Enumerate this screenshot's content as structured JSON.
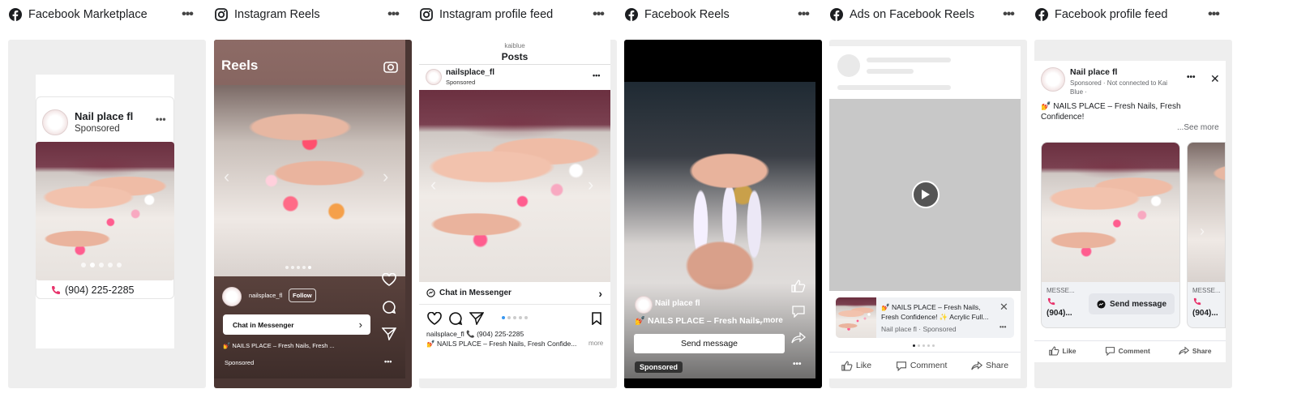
{
  "placements": [
    {
      "name": "Facebook Marketplace",
      "platform": "facebook"
    },
    {
      "name": "Instagram Reels",
      "platform": "instagram"
    },
    {
      "name": "Instagram profile feed",
      "platform": "instagram"
    },
    {
      "name": "Facebook Reels",
      "platform": "facebook"
    },
    {
      "name": "Ads on Facebook Reels",
      "platform": "facebook"
    },
    {
      "name": "Facebook profile feed",
      "platform": "facebook"
    }
  ],
  "more_glyph": "•••",
  "marketplace": {
    "page_name": "Nail place fl",
    "sponsored": "Sponsored",
    "phone": "(904) 225-2285"
  },
  "ig_reels": {
    "title": "Reels",
    "handle": "nailsplace_fl",
    "follow": "Follow",
    "cta": "Chat in Messenger",
    "caption": "💅 NAILS PLACE – Fresh Nails, Fresh ...",
    "sponsored": "Sponsored"
  },
  "ig_profile": {
    "account": "kaiblue",
    "posts": "Posts",
    "handle": "nailsplace_fl",
    "sponsored": "Sponsored",
    "cta": "Chat in Messenger",
    "caption_line1": "nailsplace_fl 📞 (904) 225-2285",
    "caption_line2": "💅 NAILS PLACE – Fresh Nails, Fresh Confide...",
    "more": "more"
  },
  "fb_reels": {
    "page_name": "Nail place fl",
    "caption": "💅 NAILS PLACE – Fresh Nails,",
    "more": "...more",
    "cta": "Send message",
    "sponsored": "Sponsored"
  },
  "ads_fb_reels": {
    "ad_text": "💅 NAILS PLACE – Fresh Nails, Fresh Confidence! ✨ Acrylic Full...",
    "meta": "Nail place fl · Sponsored",
    "like": "Like",
    "comment": "Comment",
    "share": "Share"
  },
  "fb_profile": {
    "page_name": "Nail place fl",
    "meta": "Sponsored · Not connected to Kai Blue ·",
    "text": "💅 NAILS PLACE – Fresh Nails, Fresh Confidence!",
    "see_more": "...See more",
    "card1_label": "MESSE...",
    "card1_phone": "(904)...",
    "card1_cta": "Send message",
    "card2_label": "MESSE...",
    "card2_phone": "(904)...",
    "like": "Like",
    "comment": "Comment",
    "share": "Share"
  },
  "colors": {
    "facebook": "#1c1e21",
    "accent_pink": "#e8336b",
    "page_bg": "#eeeeee"
  }
}
